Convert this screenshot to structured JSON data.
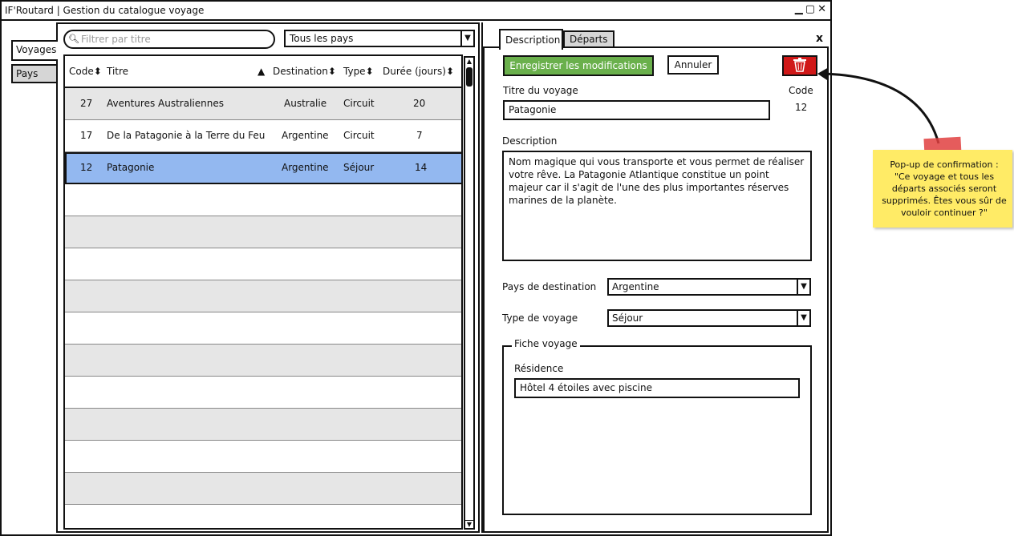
{
  "window": {
    "title": "IF'Routard | Gestion du catalogue voyage",
    "controls": [
      "▁",
      "▢",
      "✕"
    ]
  },
  "vertical_tabs": [
    "Voyages",
    "Pays"
  ],
  "filter": {
    "placeholder": "Filtrer par titre",
    "country": "Tous les pays"
  },
  "table": {
    "headers": {
      "code": "Code",
      "title": "Titre",
      "destination": "Destination",
      "type": "Type",
      "duration": "Durée (jours)"
    },
    "rows": [
      {
        "code": "27",
        "title": "Aventures Australiennes",
        "destination": "Australie",
        "type": "Circuit",
        "duration": "20"
      },
      {
        "code": "17",
        "title": "De la Patagonie à la Terre du Feu",
        "destination": "Argentine",
        "type": "Circuit",
        "duration": "7"
      },
      {
        "code": "12",
        "title": "Patagonie",
        "destination": "Argentine",
        "type": "Séjour",
        "duration": "14"
      }
    ],
    "selected_row": "12"
  },
  "detail": {
    "tabs": [
      "Description",
      "Départs"
    ],
    "buttons": {
      "save": "Enregistrer les modifications",
      "cancel": "Annuler"
    },
    "title_label": "Titre du voyage",
    "title_value": "Patagonie",
    "code_label": "Code",
    "code_value": "12",
    "description_label": "Description",
    "description_value": "Nom magique qui vous transporte et vous permet de réaliser votre rêve. La Patagonie Atlantique constitue un point majeur car il s'agit de l'une des plus importantes réserves marines de la planète.",
    "country_label": "Pays de destination",
    "country_value": "Argentine",
    "type_label": "Type de voyage",
    "type_value": "Séjour",
    "sheet_legend": "Fiche voyage",
    "residence_label": "Résidence",
    "residence_value": "Hôtel 4 étoiles avec piscine"
  },
  "note": {
    "text": "Pop-up de confirmation : \"Ce voyage et tous les départs associés seront supprimés. Êtes vous sûr de vouloir continuer ?\""
  },
  "colors": {
    "save_button": "#6ab04c",
    "delete_button": "#d01818",
    "selected_row": "#93b8f0",
    "note": "#ffeb66"
  }
}
